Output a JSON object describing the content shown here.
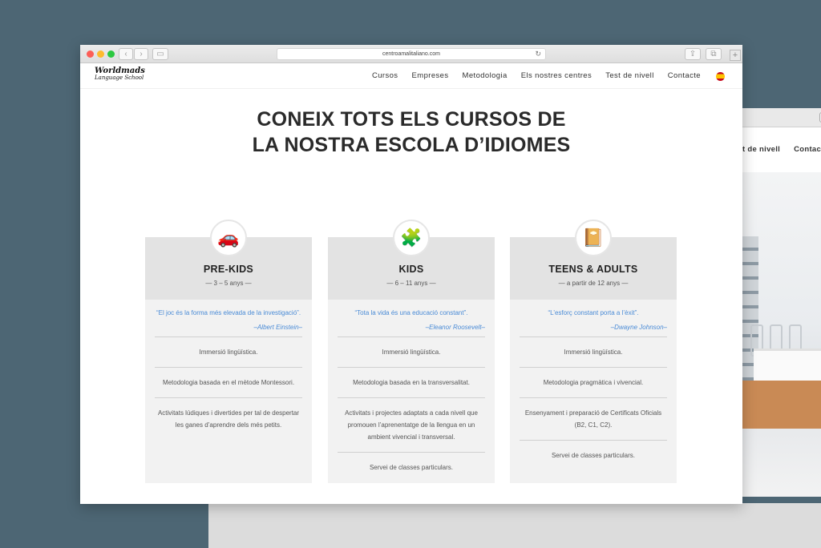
{
  "browser": {
    "url": "centroamalitaliano.com"
  },
  "background_window": {
    "nav": [
      "t de nivell",
      "Contac"
    ]
  },
  "site": {
    "logo_main": "Worldmads",
    "logo_sub": "Language School",
    "menu": [
      "Cursos",
      "Empreses",
      "Metodologia",
      "Els nostres centres",
      "Test de nivell",
      "Contacte"
    ]
  },
  "heading": {
    "line1": "CONEIX TOTS ELS CURSOS DE",
    "line2": "LA NOSTRA ESCOLA D’IDIOMES"
  },
  "cards": [
    {
      "icon": "toy-car-icon",
      "title": "PRE-KIDS",
      "age": "— 3 – 5 anys —",
      "quote": "“El joc és la forma més elevada de la investigació”.",
      "author": "–Albert Einstein–",
      "items": [
        "Immersió lingüística.",
        "Metodologia basada en el mètode Montessori.",
        "Activitats lúdiques i divertides per tal de despertar les ganes d’aprendre dels més petits."
      ]
    },
    {
      "icon": "puzzle-icon",
      "title": "KIDS",
      "age": "— 6 – 11 anys —",
      "quote": "“Tota la vida és una educació constant”.",
      "author": "–Eleanor Roosevelt–",
      "items": [
        "Immersió lingüística.",
        "Metodologia basada en la transversalitat.",
        "Activitats i projectes adaptats a cada nivell que promouen l’aprenentatge de la llengua en un ambient vivencial i transversal.",
        "Servei de classes particulars."
      ]
    },
    {
      "icon": "notebook-icon",
      "title": "TEENS & ADULTS",
      "age": "— a partir de 12 anys —",
      "quote": "“L’esforç constant porta a l’èxit”.",
      "author": "–Dwayne Johnson–",
      "items": [
        "Immersió lingüística.",
        "Metodologia pragmàtica i vivencial.",
        "Ensenyament i preparació de Certificats Oficials (B2, C1, C2).",
        "Servei de classes particulars."
      ]
    }
  ]
}
